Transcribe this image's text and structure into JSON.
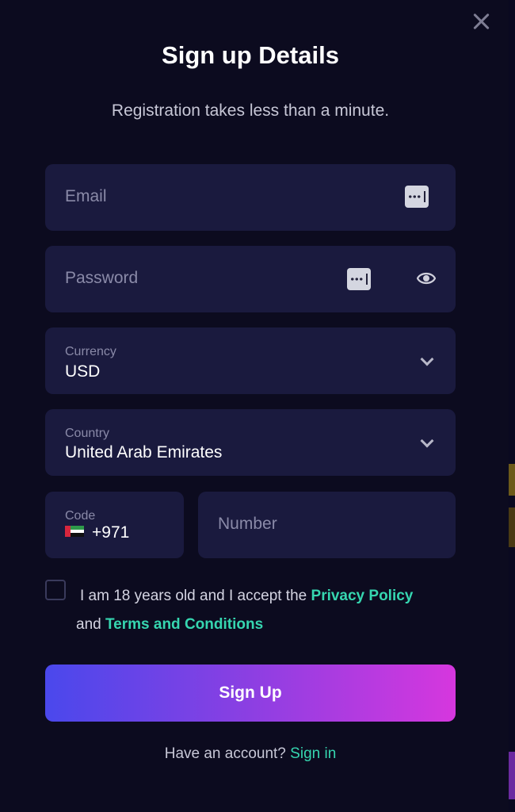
{
  "dialog": {
    "title": "Sign up Details",
    "subtitle": "Registration takes less than a minute."
  },
  "email": {
    "placeholder": "Email"
  },
  "password": {
    "placeholder": "Password"
  },
  "currency": {
    "label": "Currency",
    "value": "USD"
  },
  "country": {
    "label": "Country",
    "value": "United Arab Emirates"
  },
  "phone": {
    "code_label": "Code",
    "code_value": "+971",
    "flag": "uae-flag-icon",
    "number_placeholder": "Number"
  },
  "consent": {
    "text_1": "I am 18 years old and I accept the ",
    "privacy_link": "Privacy Policy",
    "text_2": " and ",
    "terms_link": "Terms and Conditions",
    "checked": false
  },
  "signup_button": "Sign Up",
  "footer": {
    "prompt": "Have an account? ",
    "signin_link": "Sign in"
  },
  "colors": {
    "background": "#0c0b1f",
    "field_bg": "#1a1a3e",
    "accent_link": "#36d6b0",
    "button_gradient_start": "#4a48ec",
    "button_gradient_end": "#d637de"
  },
  "icons": [
    "close-icon",
    "password-manager-icon",
    "eye-icon",
    "chevron-down-icon",
    "uae-flag-icon"
  ]
}
